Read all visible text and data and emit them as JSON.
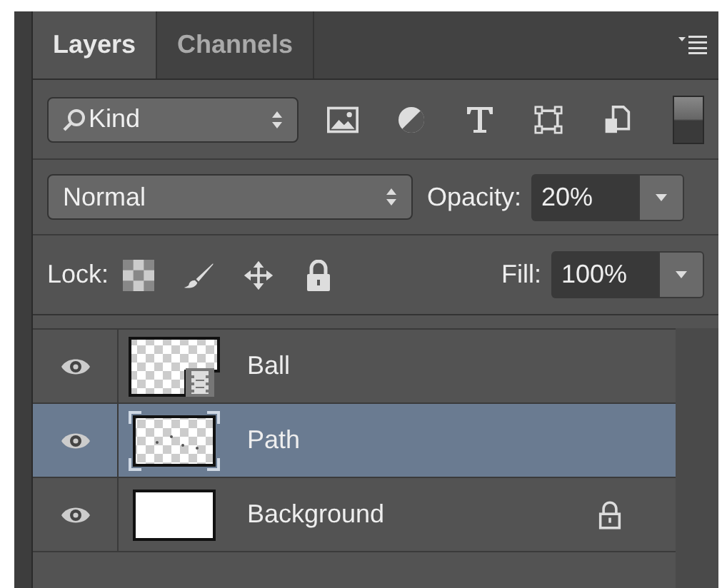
{
  "tabs": [
    {
      "label": "Layers",
      "selected": true
    },
    {
      "label": "Channels",
      "selected": false
    }
  ],
  "filter": {
    "value": "Kind"
  },
  "blend_mode": {
    "value": "Normal"
  },
  "opacity": {
    "label": "Opacity:",
    "value": "20%"
  },
  "lock": {
    "label": "Lock:"
  },
  "fill": {
    "label": "Fill:",
    "value": "100%"
  },
  "layers": [
    {
      "name": "Ball",
      "kind": "smart",
      "visible": true,
      "selected": false,
      "locked": false
    },
    {
      "name": "Path",
      "kind": "pixel",
      "visible": true,
      "selected": true,
      "locked": false
    },
    {
      "name": "Background",
      "kind": "solid",
      "visible": true,
      "selected": false,
      "locked": true
    }
  ]
}
